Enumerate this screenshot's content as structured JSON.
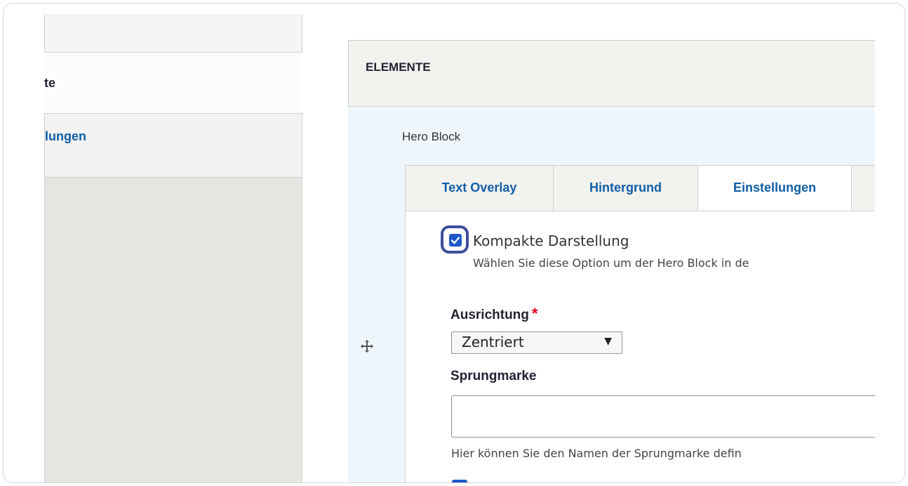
{
  "sidebar": {
    "item1_label": "te",
    "item2_label": "lungen"
  },
  "panel": {
    "title": "ELEMENTE",
    "block_label": "Hero Block"
  },
  "tabs": [
    {
      "label": "Text Overlay"
    },
    {
      "label": "Hintergrund"
    },
    {
      "label": "Einstellungen"
    }
  ],
  "settings": {
    "compact": {
      "checked": true,
      "label": "Kompakte Darstellung",
      "description": "Wählen Sie diese Option um der Hero Block in de"
    },
    "alignment": {
      "label": "Ausrichtung",
      "required_mark": "*",
      "value": "Zentriert"
    },
    "anchor": {
      "label": "Sprungmarke",
      "value": "",
      "help": "Hier können Sie den Namen der Sprungmarke defin"
    }
  },
  "colors": {
    "link": "#0f5ea6",
    "checkbox": "#1d58c9",
    "focus_ring": "#3d4f9a",
    "required": "#e3001b"
  }
}
